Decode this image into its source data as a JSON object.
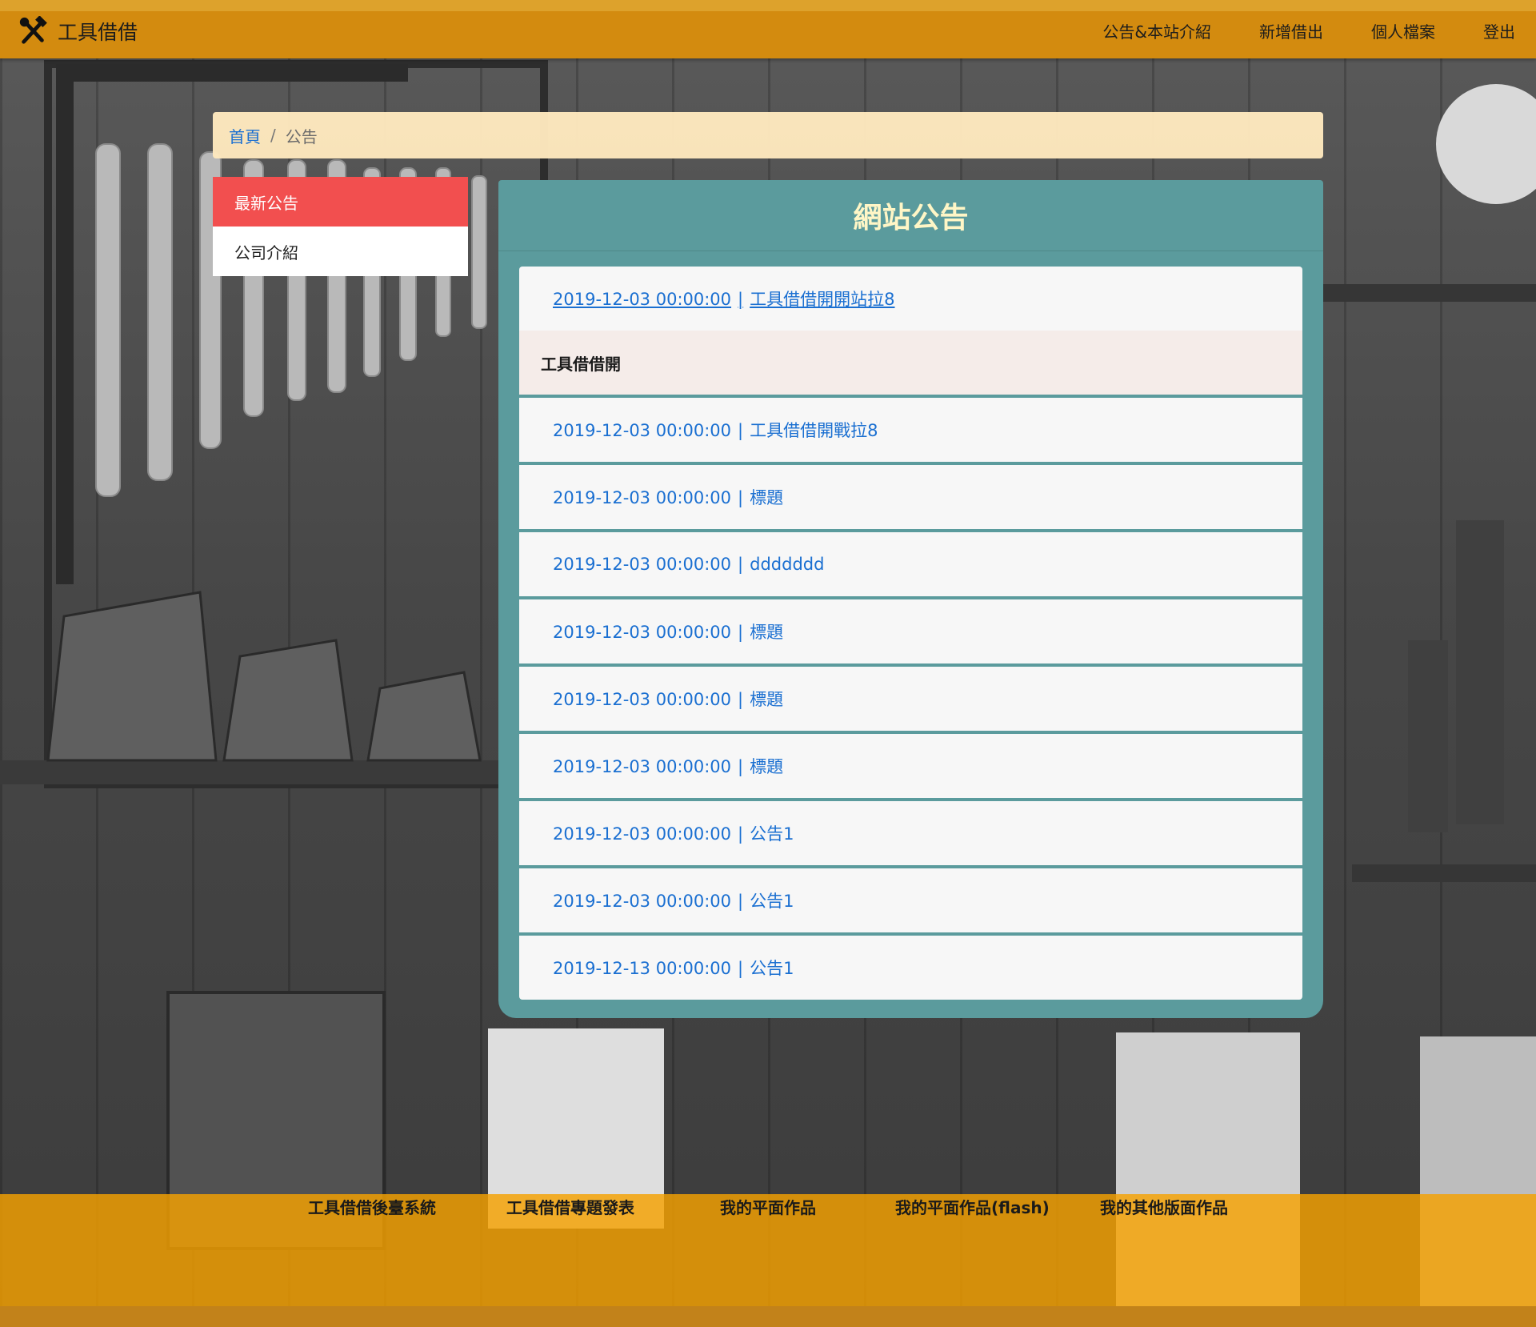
{
  "brand": {
    "name": "工具借借",
    "logo_icon": "tools-icon"
  },
  "nav": {
    "links": [
      "公告&本站介紹",
      "新增借出",
      "個人檔案",
      "登出"
    ]
  },
  "breadcrumb": {
    "home": "首頁",
    "separator": "/",
    "current": "公告"
  },
  "sidebar": {
    "items": [
      {
        "label": "最新公告",
        "active": true
      },
      {
        "label": "公司介紹",
        "active": false
      }
    ]
  },
  "panel": {
    "title": "網站公告",
    "announcements": [
      {
        "date": "2019-12-03 00:00:00",
        "title": "工具借借開開站拉8",
        "expanded": true,
        "detail": "工具借借開"
      },
      {
        "date": "2019-12-03 00:00:00",
        "title": "工具借借開戰拉8"
      },
      {
        "date": "2019-12-03 00:00:00",
        "title": "標題"
      },
      {
        "date": "2019-12-03 00:00:00",
        "title": "ddddddd"
      },
      {
        "date": "2019-12-03 00:00:00",
        "title": "標題"
      },
      {
        "date": "2019-12-03 00:00:00",
        "title": "標題"
      },
      {
        "date": "2019-12-03 00:00:00",
        "title": "標題"
      },
      {
        "date": "2019-12-03 00:00:00",
        "title": "公告1"
      },
      {
        "date": "2019-12-03 00:00:00",
        "title": "公告1"
      },
      {
        "date": "2019-12-13 00:00:00",
        "title": "公告1"
      }
    ],
    "separator": "|"
  },
  "footer": {
    "links": [
      "工具借借後臺系統",
      "工具借借專題發表",
      "我的平面作品",
      "我的平面作品(flash)",
      "我的其他版面作品"
    ]
  },
  "colors": {
    "navbar": "#d38b0f",
    "breadcrumb_bg": "#fee8be",
    "active_menu": "#f24f4f",
    "panel": "#5b9b9d",
    "panel_title": "#fff6c6",
    "link": "#1a6fd1",
    "footer": "#f5a100"
  }
}
